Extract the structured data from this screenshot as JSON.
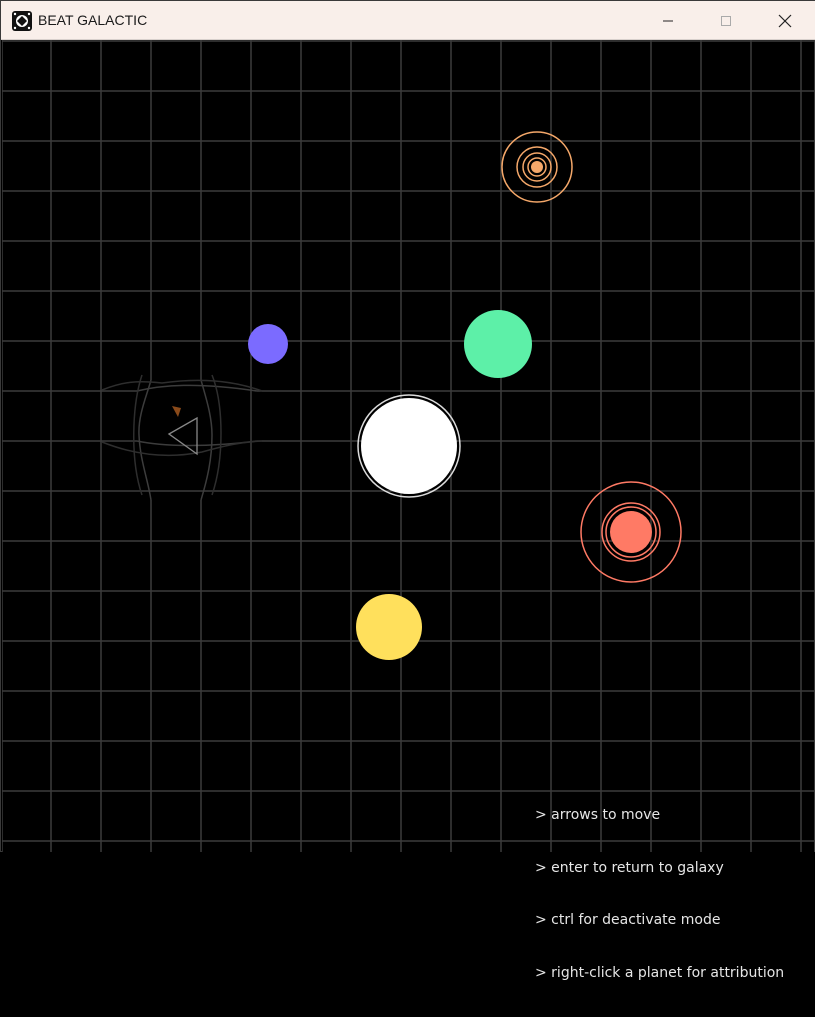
{
  "window": {
    "title": "BEAT GALACTIC",
    "controls": {
      "minimize": "minimize",
      "maximize": "maximize",
      "close": "close"
    }
  },
  "colors": {
    "background": "#000000",
    "grid": "#3c3c3c",
    "planet_purple": "#7b6bff",
    "planet_green": "#5df0a8",
    "planet_white": "#ffffff",
    "planet_yellow": "#ffe05c",
    "planet_red": "#ff7a65",
    "planet_orange": "#f5a86a",
    "text": "#e6e6e6"
  },
  "instructions": [
    "> arrows to move",
    "> enter to return to galaxy",
    "> ctrl for deactivate mode",
    "> right-click a planet for attribution"
  ]
}
